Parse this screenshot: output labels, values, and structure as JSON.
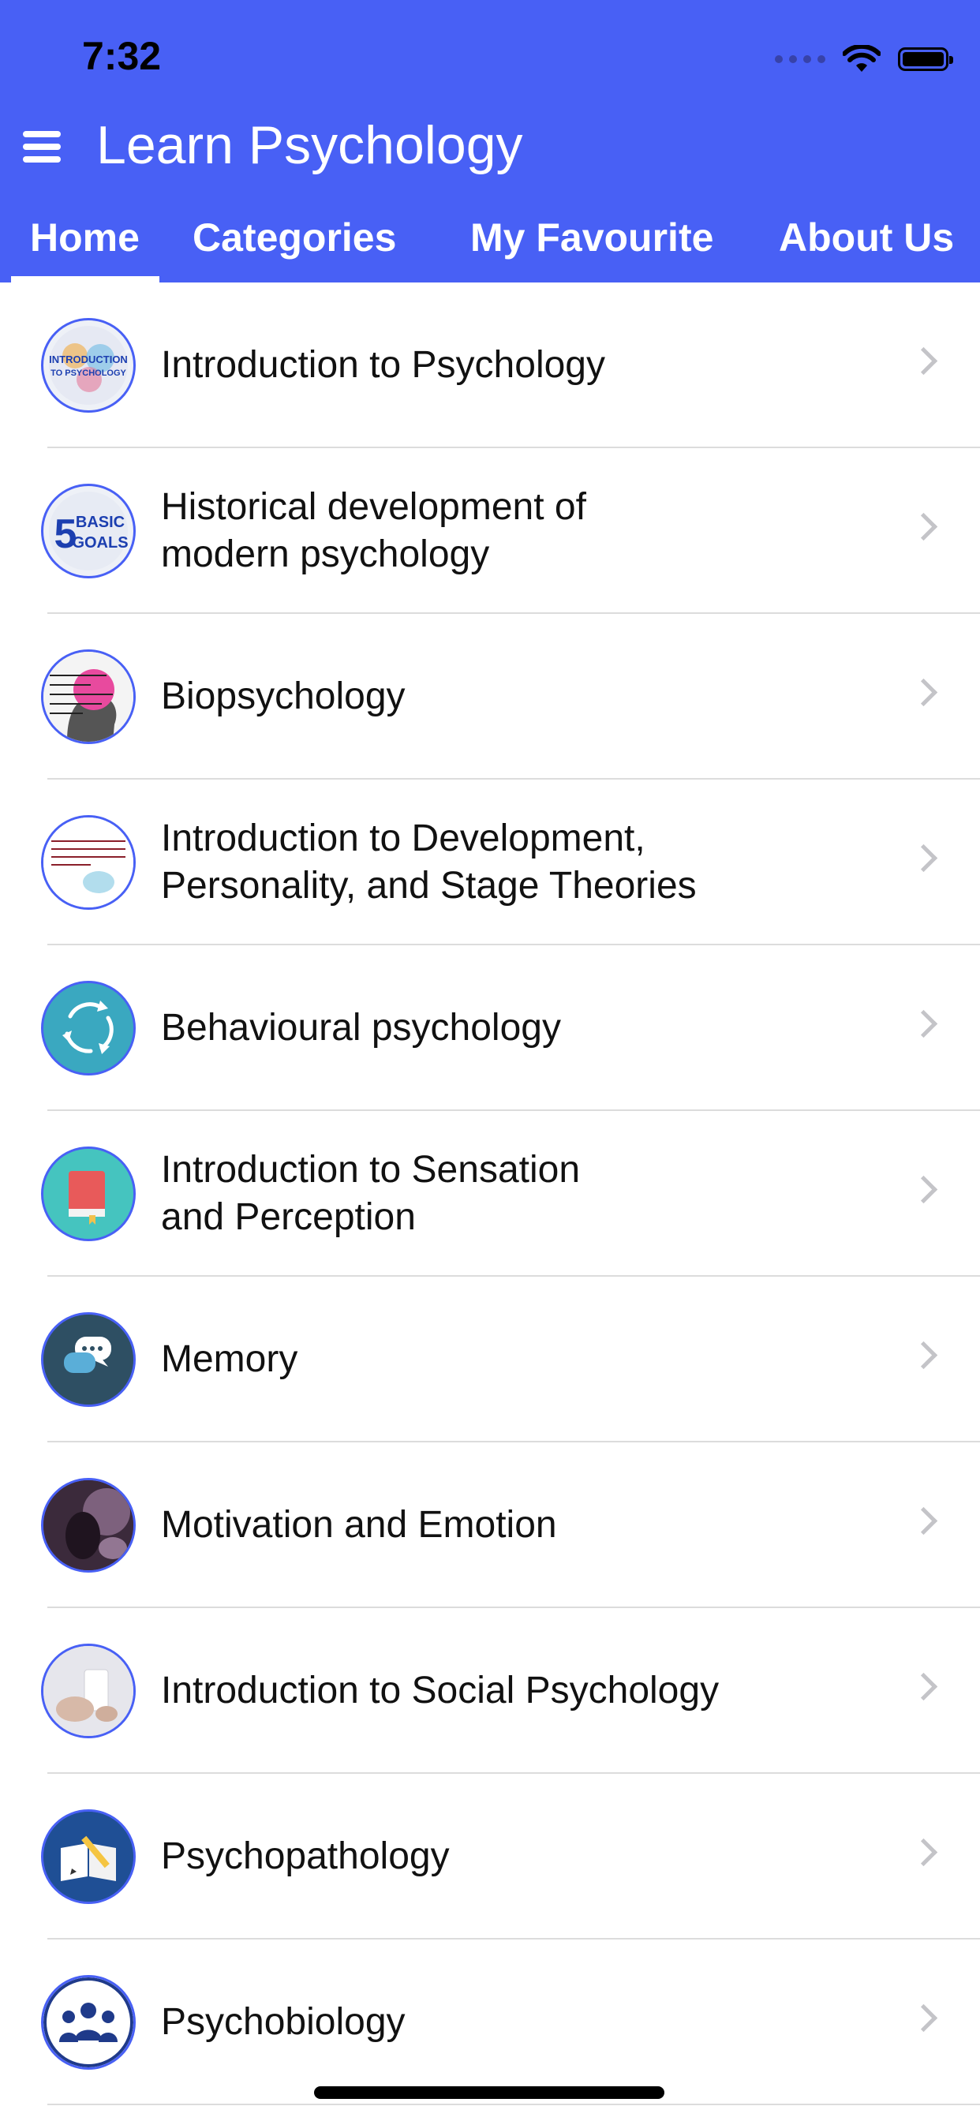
{
  "status_bar": {
    "time": "7:32"
  },
  "header": {
    "app_title": "Learn Psychology",
    "color": "#4860F5"
  },
  "tabs": [
    {
      "label": "Home",
      "selected": true
    },
    {
      "label": "Categories",
      "selected": false
    },
    {
      "label": "My Favourite",
      "selected": false
    },
    {
      "label": "About Us",
      "selected": false
    }
  ],
  "topics": [
    {
      "label": "Introduction to Psychology",
      "icon": "intro-psychology-thumb"
    },
    {
      "label": "Historical development of\nmodern psychology",
      "icon": "five-basic-goals-thumb"
    },
    {
      "label": "Biopsychology",
      "icon": "biopsychology-thumb"
    },
    {
      "label": "Introduction to Development,\nPersonality, and Stage Theories",
      "icon": "development-thumb"
    },
    {
      "label": "Behavioural psychology",
      "icon": "cycle-arrows-thumb"
    },
    {
      "label": "Introduction to Sensation\nand Perception",
      "icon": "book-thumb"
    },
    {
      "label": "Memory",
      "icon": "chat-bubbles-thumb"
    },
    {
      "label": "Motivation and Emotion",
      "icon": "photo-hand-thumb"
    },
    {
      "label": "Introduction to Social Psychology",
      "icon": "photo-phone-thumb"
    },
    {
      "label": "Psychopathology",
      "icon": "notebook-pencil-thumb"
    },
    {
      "label": "Psychobiology",
      "icon": "group-people-thumb"
    }
  ],
  "thumb_text": {
    "intro": "INTRODUCTION TO PSYCHOLOGY",
    "goals_num": "5",
    "goals_word": "BASIC GOALS"
  }
}
